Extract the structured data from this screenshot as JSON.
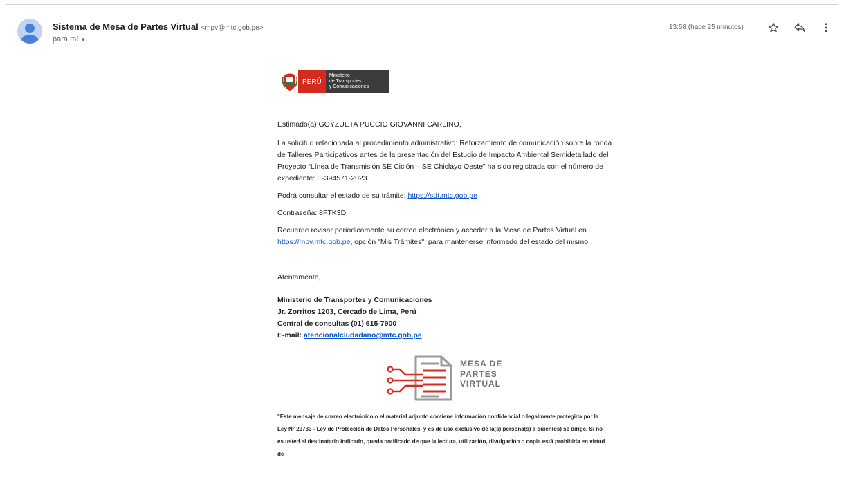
{
  "header": {
    "sender_name": "Sistema de Mesa de Partes Virtual",
    "sender_email": "<mpv@mtc.gob.pe>",
    "recipient": "para mí",
    "timestamp": "13:58 (hace 25 minutos)"
  },
  "logo": {
    "country": "PERÚ",
    "ministry_lines": [
      "Ministerio",
      "de Transportes",
      "y Comunicaciones"
    ]
  },
  "email": {
    "greeting": "Estimado(a) GOYZUETA PUCCIO GIOVANNI CARLINO,",
    "paragraph1": "La solicitud relacionada al procedimiento administrativo: Reforzamiento de comunicación sobre la ronda de Talleres Participativos antes de la presentación del Estudio de Impacto Ambiental Semidetallado del Proyecto “Línea de Transmisión SE Ciclón – SE Chiclayo Oeste” ha sido registrada con el número de expediente: E-394571-2023",
    "consult_prefix": "Podrá consultar el estado de su trámite: ",
    "consult_link": "https://sdt.mtc.gob.pe",
    "password": "Contraseña: 8FTK3D",
    "reminder_prefix": "Recuerde revisar periódicamente su correo electrónico y acceder a la Mesa de Partes Virtual en ",
    "reminder_link": "https://mpv.mtc.gob.pe",
    "reminder_suffix": ", opción \"Mis Trámites\", para mantenerse informado del estado del mismo.",
    "closing": "Atentamente,",
    "org_name": "Ministerio de Transportes y Comunicaciones",
    "org_address": "Jr. Zorritos 1203, Cercado de Lima, Perú",
    "org_phone": "Central de consultas (01) 615-7900",
    "org_email_label": "E-mail: ",
    "org_email": "atencionalciudadano@mtc.gob.pe",
    "disclaimer": "\"Este mensaje de correo electrónico o el material adjunto contiene información confidencial o legalmente protegida por la Ley N° 29733 - Ley de Protección de Datos Personales, y es de uso exclusivo de la(s) persona(s) a quién(es) se dirige. Si no es usted el destinatario indicado, queda notificado de que la lectura, utilización, divulgación o copia está prohibida en virtud de"
  },
  "mpv_logo": {
    "line1": "MESA DE",
    "line2": "PARTES",
    "line3": "VIRTUAL"
  },
  "icons": [
    "avatar-icon",
    "star-icon",
    "reply-icon",
    "more-vert-icon",
    "shield-icon"
  ],
  "colors": {
    "link": "#1155cc",
    "peru_red": "#d52b1e",
    "ministry_bg": "#3c3c3c",
    "avatar": "#4a7fd8"
  }
}
